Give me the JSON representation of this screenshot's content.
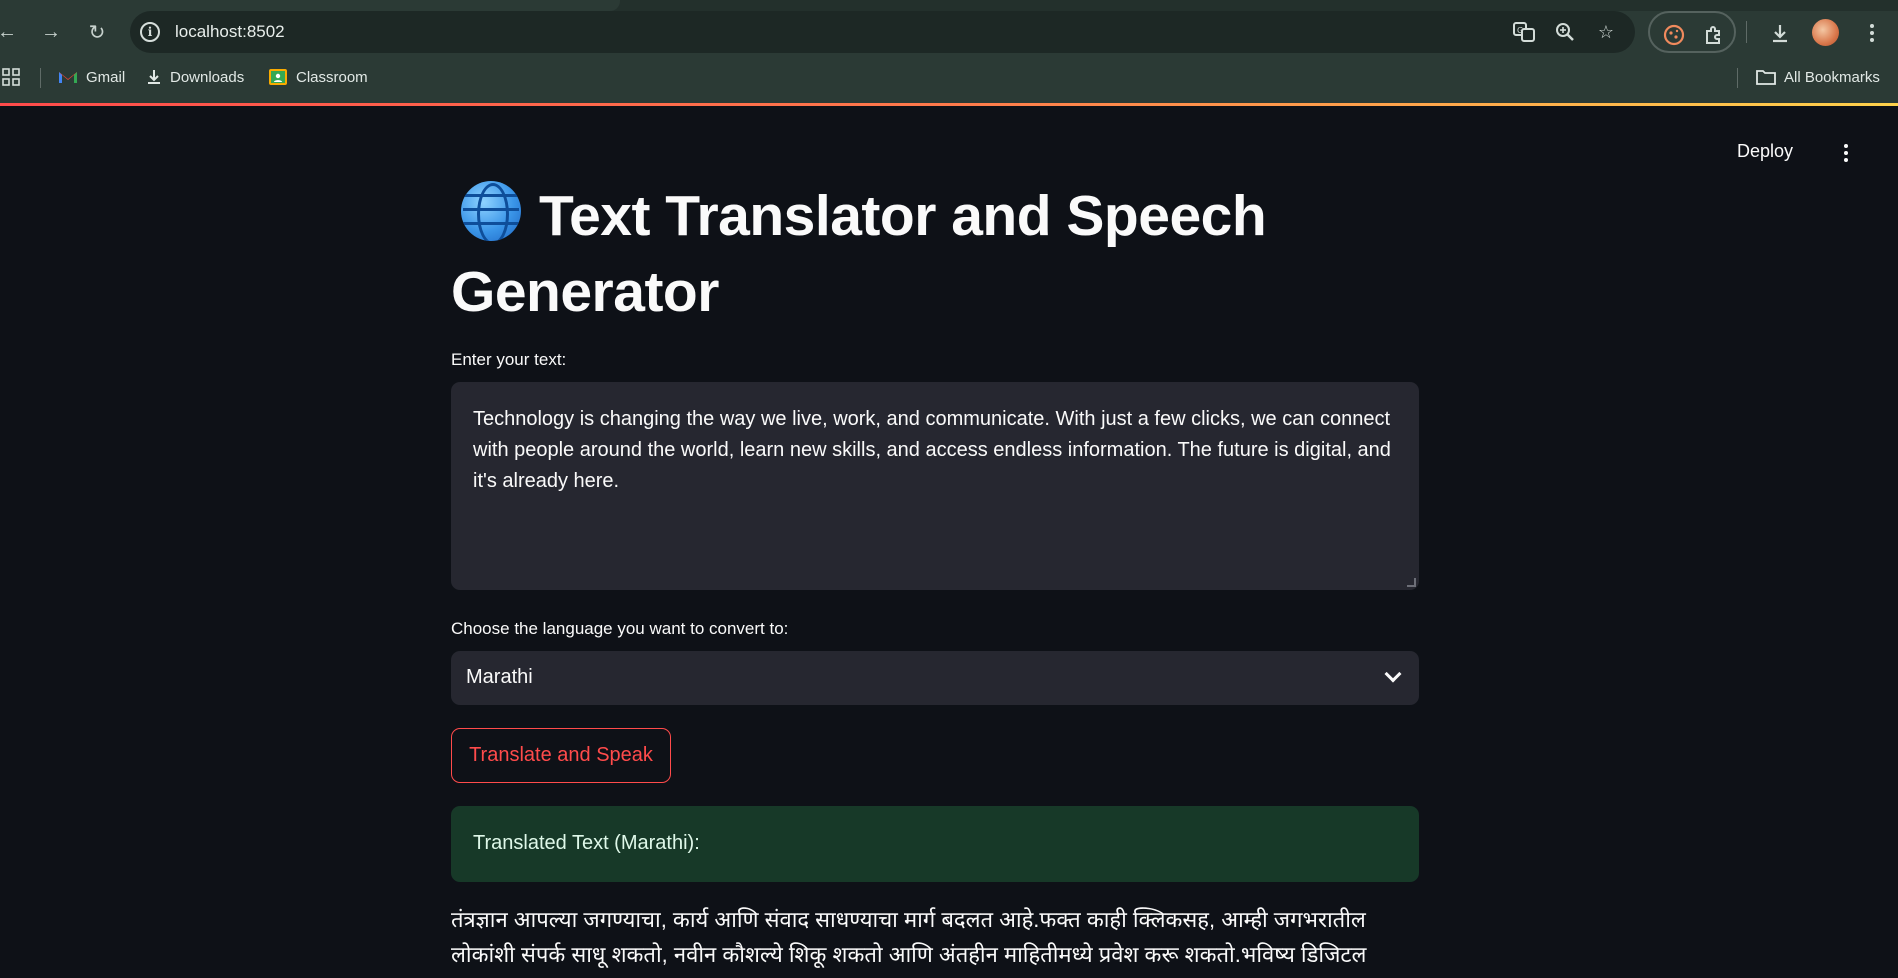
{
  "browser": {
    "url": "localhost:8502",
    "bookmarks": [
      {
        "label": "Gmail",
        "icon": "gmail-icon"
      },
      {
        "label": "Downloads",
        "icon": "download-icon"
      },
      {
        "label": "Classroom",
        "icon": "classroom-icon"
      }
    ],
    "all_bookmarks": "All Bookmarks"
  },
  "app": {
    "deploy_label": "Deploy",
    "title": "Text Translator and Speech Generator",
    "title_icon": "globe-icon",
    "input_label": "Enter your text:",
    "input_value": "Technology is changing the way we live, work, and communicate. With just a few clicks, we can connect with people around the world, learn new skills, and access endless information. The future is digital, and it's already here.",
    "language_label": "Choose the language you want to convert to:",
    "language_selected": "Marathi",
    "button_label": "Translate and Speak",
    "success_message": "Translated Text (Marathi):",
    "translated_text": "तंत्रज्ञान आपल्या जगण्याचा, कार्य आणि संवाद साधण्याचा मार्ग बदलत आहे.फक्त काही क्लिकसह, आम्ही जगभरातील लोकांशी संपर्क साधू शकतो, नवीन कौशल्ये शिकू शकतो आणि अंतहीन माहितीमध्ये प्रवेश करू शकतो.भविष्य डिजिटल"
  },
  "colors": {
    "background": "#0e1117",
    "widget": "#262730",
    "primary": "#ff4b4b",
    "success_bg": "#173928",
    "chrome": "#2b3a35"
  }
}
